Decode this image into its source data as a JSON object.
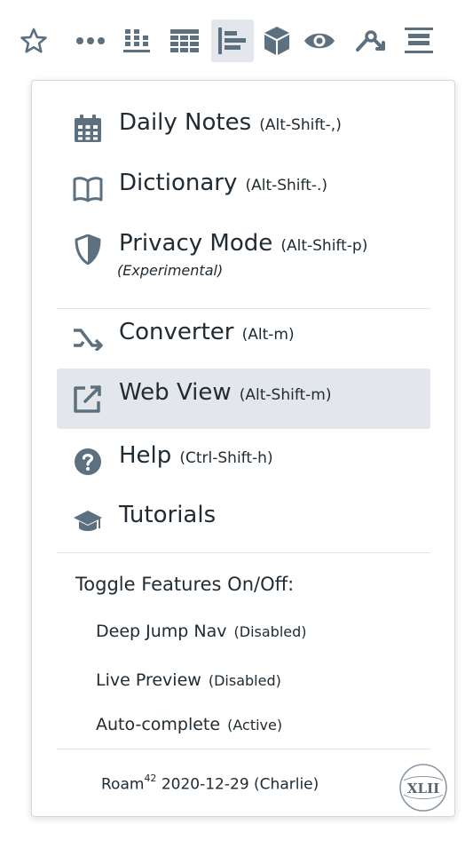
{
  "toolbar": {
    "icons": [
      "star-icon",
      "more-icon",
      "column-chart-icon",
      "table-icon",
      "align-left-icon",
      "cube-icon",
      "eye-icon",
      "key-icon",
      "align-center-icon"
    ],
    "active_index": 4
  },
  "menu": {
    "items": [
      {
        "label": "Daily Notes",
        "shortcut": "(Alt-Shift-,)",
        "icon": "calendar-icon"
      },
      {
        "label": "Dictionary",
        "shortcut": "(Alt-Shift-.)",
        "icon": "book-icon"
      },
      {
        "label": "Privacy Mode",
        "shortcut": "(Alt-Shift-p)",
        "note": "(Experimental)",
        "icon": "shield-icon"
      },
      {
        "label": "Converter",
        "shortcut": "(Alt-m)",
        "icon": "converter-icon"
      },
      {
        "label": "Web View",
        "shortcut": "(Alt-Shift-m)",
        "icon": "external-link-icon"
      },
      {
        "label": "Help",
        "shortcut": "(Ctrl-Shift-h)",
        "icon": "help-icon"
      },
      {
        "label": "Tutorials",
        "shortcut": "",
        "icon": "graduation-cap-icon"
      }
    ],
    "active_item": "Web View",
    "toggle_title": "Toggle Features On/Off:",
    "features": [
      {
        "label": "Deep Jump Nav",
        "status": "(Disabled)"
      },
      {
        "label": "Live Preview",
        "status": "(Disabled)"
      },
      {
        "label": "Auto-complete",
        "status": "(Active)"
      }
    ],
    "footer": {
      "name": "Roam",
      "superscript": "42",
      "version": "2020-12-29 (Charlie)",
      "logo_text": "XLII"
    }
  },
  "colors": {
    "icon": "#5c7080",
    "text": "#202b33",
    "active_bg": "#e3e7eb",
    "divider": "#e1e5e8"
  }
}
